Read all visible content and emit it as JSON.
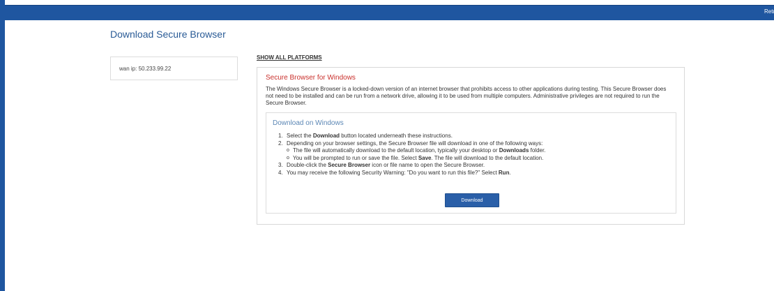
{
  "topbar": {
    "return_label": "Return"
  },
  "page": {
    "title": "Download Secure Browser"
  },
  "wan": {
    "label": "wan ip:",
    "value": "50.233.99.22"
  },
  "platforms": {
    "show_all_label": "SHOW ALL PLATFORMS"
  },
  "windows": {
    "title": "Secure Browser for Windows",
    "description": "The Windows Secure Browser is a locked-down version of an internet browser that prohibits access to other applications during testing. This Secure Browser does not need to be installed and can be run from a network drive, allowing it to be used from multiple computers. Administrative privileges are not required to run the Secure Browser.",
    "download_section": {
      "title": "Download on Windows",
      "step1": {
        "num": "1.",
        "pre": "Select the ",
        "bold": "Download",
        "post": " button located underneath these instructions."
      },
      "step2": {
        "num": "2.",
        "text": "Depending on your browser settings, the Secure Browser file will download in one of the following ways:"
      },
      "sub1": {
        "bullet": "o",
        "pre": "The file will automatically download to the default location, typically your desktop or ",
        "bold": "Downloads",
        "post": " folder."
      },
      "sub2": {
        "bullet": "o",
        "pre": "You will be prompted to run or save the file. Select ",
        "bold": "Save",
        "post": ". The file will download to the default location."
      },
      "step3": {
        "num": "3.",
        "pre": "Double-click the ",
        "bold": "Secure Browser",
        "post": " icon or file name to open the Secure Browser."
      },
      "step4": {
        "num": "4.",
        "pre": "You may receive the following Security Warning: \"Do you want to run this file?\" Select ",
        "bold": "Run",
        "post": "."
      },
      "download_button": "Download"
    }
  },
  "colors": {
    "brand_blue": "#1f56a0",
    "title_blue": "#2a5b96",
    "os_title_red": "#c9302c",
    "section_title_blue": "#5c87b5",
    "button_blue": "#2a5fa8"
  }
}
